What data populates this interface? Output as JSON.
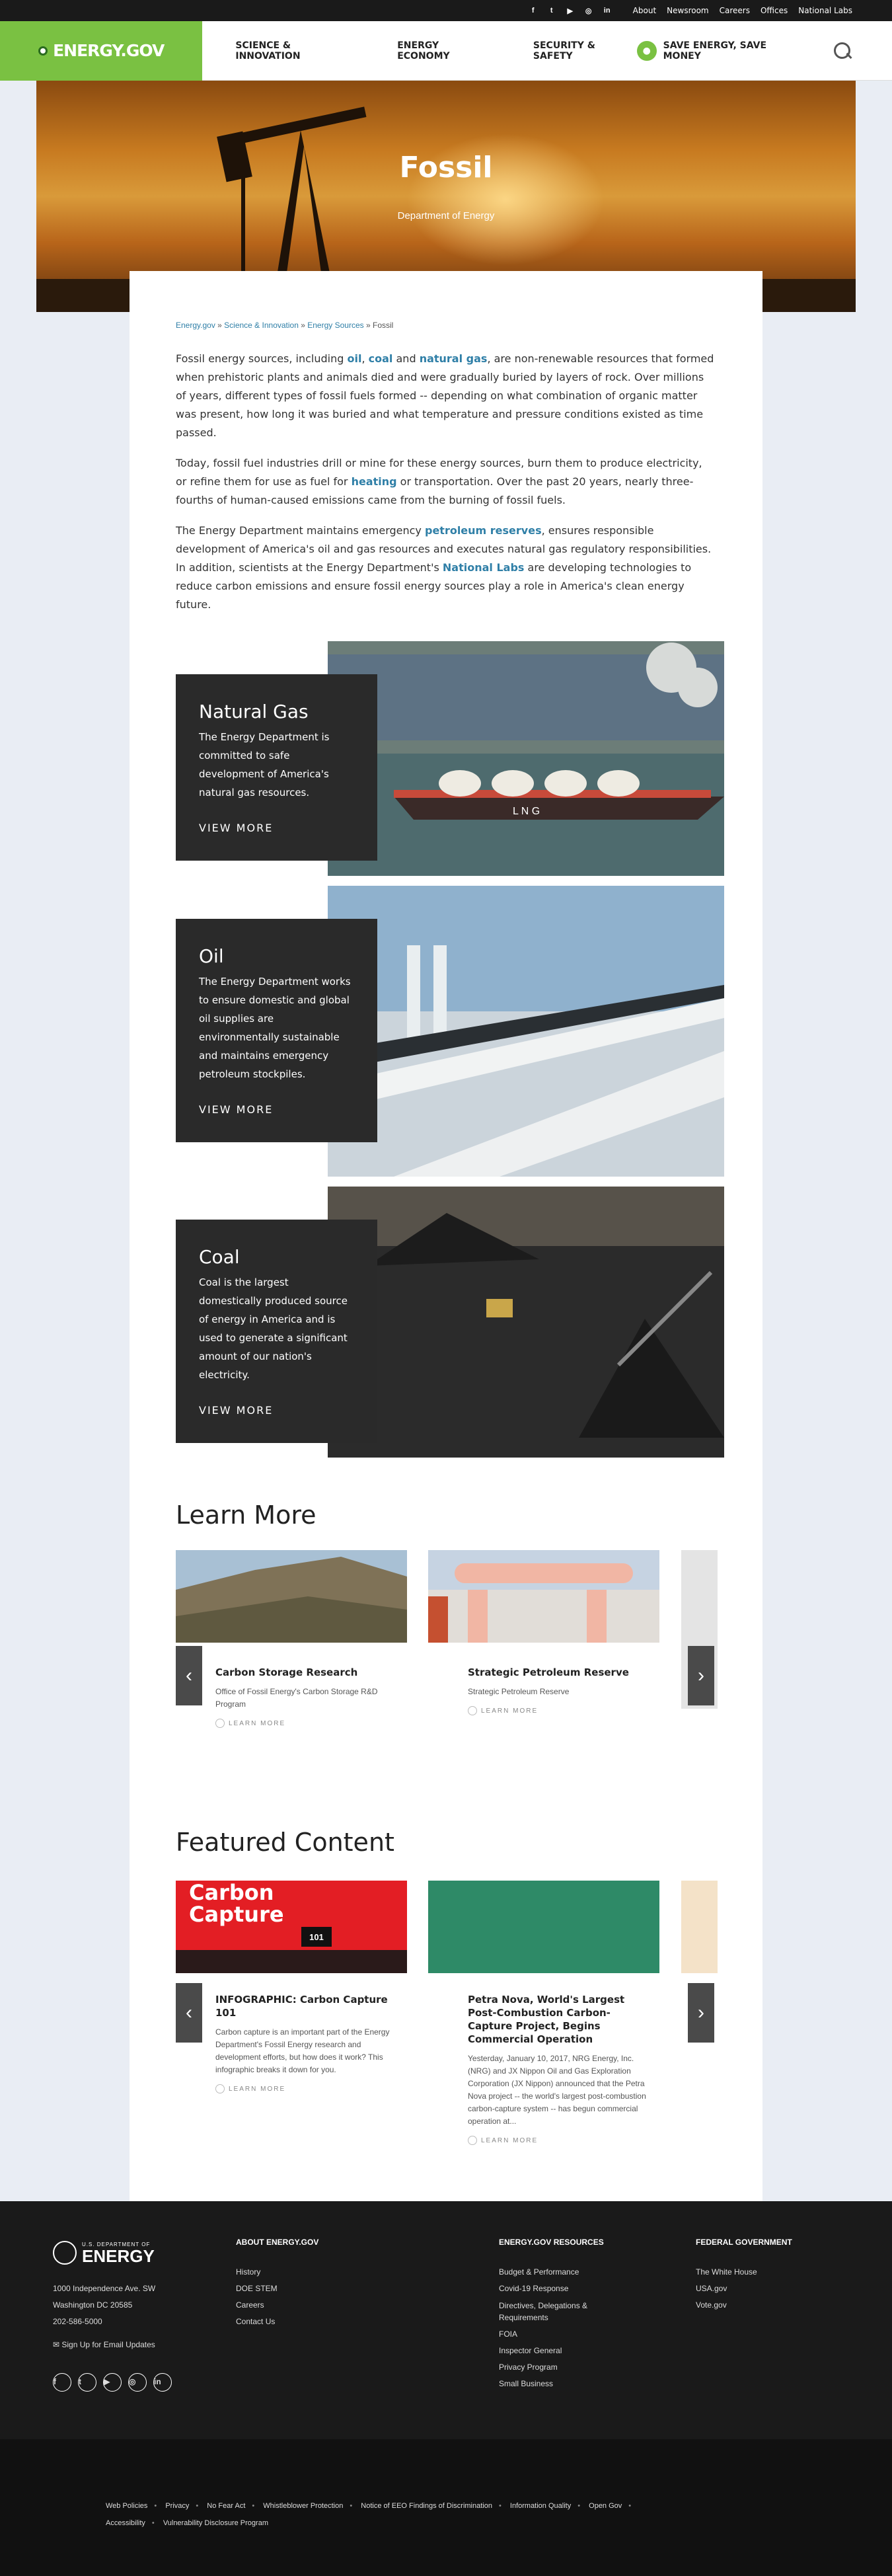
{
  "utility": {
    "social": [
      "f",
      "t",
      "▶",
      "◎",
      "in"
    ],
    "links": [
      "About",
      "Newsroom",
      "Careers",
      "Offices",
      "National Labs"
    ]
  },
  "nav": {
    "logo": "ENERGY.GOV",
    "items": [
      "SCIENCE & INNOVATION",
      "ENERGY ECONOMY",
      "SECURITY & SAFETY"
    ],
    "save": "SAVE ENERGY, SAVE MONEY"
  },
  "hero": {
    "title": "Fossil",
    "subtitle": "Department of Energy"
  },
  "breadcrumbs": [
    "Energy.gov",
    "Science & Innovation",
    "Energy Sources",
    "Fossil"
  ],
  "intro": {
    "p1": [
      "Fossil energy sources, including ",
      "oil",
      ", ",
      "coal",
      " and ",
      "natural gas",
      ", are non-renewable resources that formed when prehistoric plants and animals died and were gradually buried by layers of rock. Over millions of years, different types of fossil fuels formed -- depending on what combination of organic matter was present, how long it was buried and what temperature and pressure conditions existed as time passed."
    ],
    "p2": [
      "Today, fossil fuel industries drill or mine for these energy sources, burn them to produce electricity, or refine them for use as fuel for ",
      "heating",
      " or transportation. Over the past 20 years, nearly three-fourths of human-caused emissions came from the burning of fossil fuels."
    ],
    "p3": [
      "The Energy Department maintains emergency ",
      "petroleum reserves",
      ", ensures responsible development of America's oil and gas resources and executes natural gas regulatory responsibilities. In addition, scientists at the Energy Department's ",
      "National Labs",
      " are developing technologies to reduce carbon emissions and ensure fossil energy sources play a role in America's clean energy future."
    ]
  },
  "sources": [
    {
      "title": "Natural Gas",
      "text": "The Energy Department is committed to safe development of America's natural gas resources.",
      "cta": "VIEW MORE"
    },
    {
      "title": "Oil",
      "text": "The Energy Department works to ensure domestic and global oil supplies are environmentally sustainable and maintains emergency petroleum stockpiles.",
      "cta": "VIEW MORE"
    },
    {
      "title": "Coal",
      "text": "Coal is the largest domestically produced source of energy in America and is used to generate a significant amount of our nation's electricity.",
      "cta": "VIEW MORE"
    }
  ],
  "learn_more": {
    "heading": "Learn More",
    "items": [
      {
        "title": "Carbon Storage Research",
        "text": "Office of Fossil Energy's Carbon Storage R&D Program",
        "cta": "LEARN MORE"
      },
      {
        "title": "Strategic Petroleum Reserve",
        "text": "Strategic Petroleum Reserve",
        "cta": "LEARN MORE"
      }
    ]
  },
  "featured": {
    "heading": "Featured Content",
    "items": [
      {
        "image_text": "Carbon Capture",
        "badge": "101",
        "title": "INFOGRAPHIC: Carbon Capture 101",
        "text": "Carbon capture is an important part of the Energy Department's Fossil Energy research and development efforts, but how does it work? This infographic breaks it down for you.",
        "cta": "LEARN MORE"
      },
      {
        "title": "Petra Nova, World's Largest Post-Combustion Carbon-Capture Project, Begins Commercial Operation",
        "text": "Yesterday, January 10, 2017, NRG Energy, Inc. (NRG) and JX Nippon Oil and Gas Exploration Corporation (JX Nippon) announced that the Petra Nova project -- the world's largest post-combustion carbon-capture system -- has begun commercial operation at...",
        "cta": "LEARN MORE"
      }
    ]
  },
  "footer": {
    "seal_top": "U.S. DEPARTMENT OF",
    "seal_name": "ENERGY",
    "address": [
      "1000 Independence Ave. SW",
      "Washington DC 20585",
      "202-586-5000"
    ],
    "signup": "Sign Up for Email Updates",
    "about_heading": "ABOUT ENERGY.GOV",
    "about": [
      "History",
      "DOE STEM",
      "Careers",
      "Contact Us"
    ],
    "resources_heading": "ENERGY.GOV RESOURCES",
    "resources": [
      "Budget & Performance",
      "Covid-19 Response",
      "Directives, Delegations & Requirements",
      "FOIA",
      "Inspector General",
      "Privacy Program",
      "Small Business"
    ],
    "federal_heading": "FEDERAL GOVERNMENT",
    "federal": [
      "The White House",
      "USA.gov",
      "Vote.gov"
    ],
    "social": [
      "f",
      "t",
      "▶",
      "◎",
      "in"
    ]
  },
  "bottom_links": [
    "Web Policies",
    "Privacy",
    "No Fear Act",
    "Whistleblower Protection",
    "Notice of EEO Findings of Discrimination",
    "Information Quality",
    "Open Gov",
    "Accessibility",
    "Vulnerability Disclosure Program"
  ]
}
